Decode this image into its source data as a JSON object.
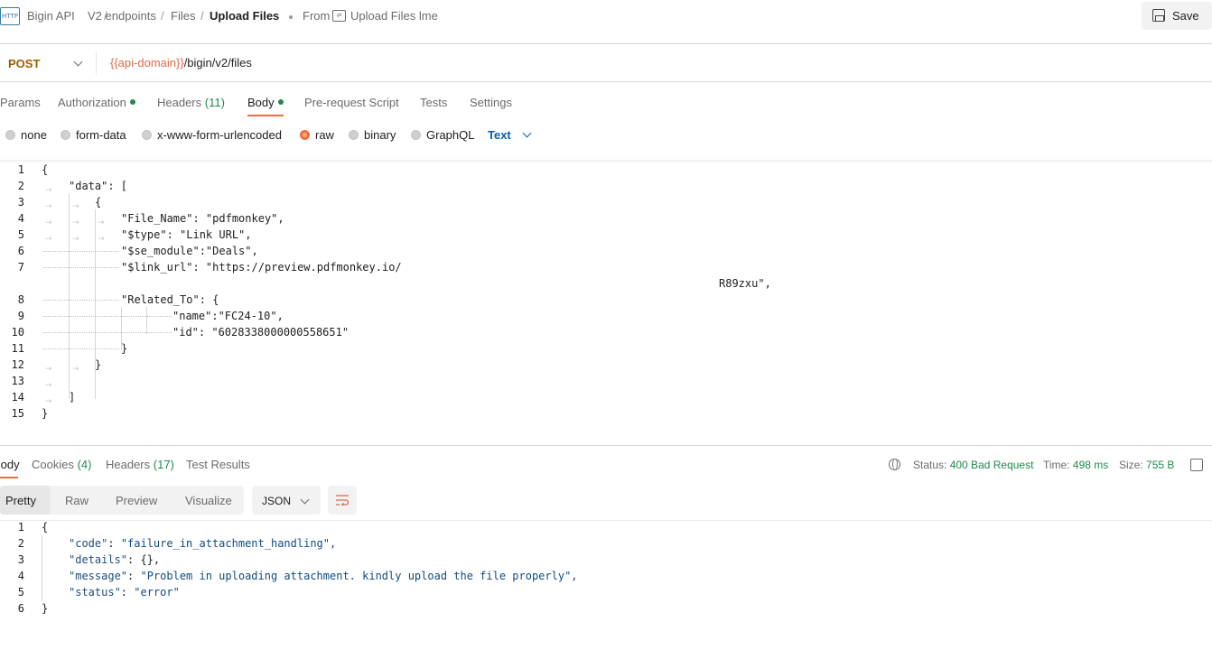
{
  "breadcrumb": {
    "items": [
      "Bigin API",
      "V2 endpoints",
      "Files"
    ],
    "current": "Upload Files",
    "separator": "/",
    "from_label": "From",
    "from_name": "Upload Files lme"
  },
  "toolbar": {
    "save_label": "Save",
    "http_icon_text": "HTTP"
  },
  "request": {
    "method": "POST",
    "url_var": "{{api-domain}}",
    "url_path": "/bigin/v2/files"
  },
  "request_tabs": [
    {
      "label": "Params"
    },
    {
      "label": "Authorization",
      "dot": true
    },
    {
      "label": "Headers",
      "count": "(11)"
    },
    {
      "label": "Body",
      "dot": true,
      "active": true
    },
    {
      "label": "Pre-request Script"
    },
    {
      "label": "Tests"
    },
    {
      "label": "Settings"
    }
  ],
  "body_types": {
    "options": [
      "none",
      "form-data",
      "x-www-form-urlencoded",
      "raw",
      "binary",
      "GraphQL"
    ],
    "selected": "raw",
    "format": "Text"
  },
  "request_body": {
    "line_numbers": [
      "1",
      "2",
      "3",
      "4",
      "5",
      "6",
      "7",
      "",
      "8",
      "9",
      "10",
      "11",
      "12",
      "13",
      "14",
      "15"
    ],
    "lines": [
      "{",
      "\"data\": [",
      "{",
      "\"File_Name\": \"pdfmonkey\",",
      "\"$type\": \"Link URL\",",
      "\"$se_module\":\"Deals\",",
      "\"$link_url\": \"https://preview.pdfmonkey.io/",
      "R89zxu\",",
      "\"Related_To\": {",
      "\"name\":\"FC24-10\",",
      "\"id\": \"6028338000000558651\"",
      "}",
      "}",
      "",
      "]",
      "}"
    ]
  },
  "response": {
    "tabs": [
      {
        "label": "Body",
        "active": true
      },
      {
        "label": "Cookies",
        "count": "(4)"
      },
      {
        "label": "Headers",
        "count": "(17)"
      },
      {
        "label": "Test Results"
      }
    ],
    "status_label": "Status:",
    "status_value": "400 Bad Request",
    "time_label": "Time:",
    "time_value": "498 ms",
    "size_label": "Size:",
    "size_value": "755 B",
    "views": [
      "Pretty",
      "Raw",
      "Preview",
      "Visualize"
    ],
    "active_view": "Pretty",
    "format": "JSON",
    "line_numbers": [
      "1",
      "2",
      "3",
      "4",
      "5",
      "6"
    ],
    "lines": [
      {
        "text": "{"
      },
      {
        "key": "\"code\"",
        "value": "\"failure_in_attachment_handling\","
      },
      {
        "key": "\"details\"",
        "value": "{},"
      },
      {
        "key": "\"message\"",
        "value": "\"Problem in uploading attachment. kindly upload the file properly\","
      },
      {
        "key": "\"status\"",
        "value": "\"error\""
      },
      {
        "text": "}"
      }
    ]
  },
  "icons": {
    "http": "http-request-icon",
    "fork": "fork-icon",
    "save": "save-icon",
    "dropdown": "chevron-down-icon",
    "globe": "globe-icon",
    "wrap": "wrap-lines-icon"
  },
  "colors": {
    "accent": "#f26b3a",
    "method": "#a15c00",
    "variable": "#e0694d",
    "success": "#1f8a4c",
    "link": "#0b5cad"
  }
}
